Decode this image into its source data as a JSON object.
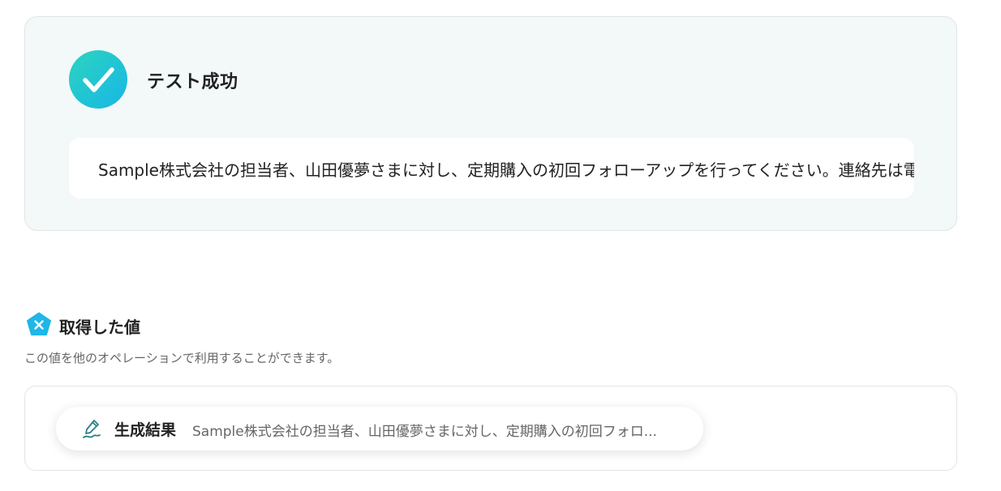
{
  "test_result": {
    "status_title": "テスト成功",
    "output_text": "Sample株式会社の担当者、山田優夢さまに対し、定期購入の初回フォローアップを行ってください。連絡先は電"
  },
  "retrieved_values": {
    "title": "取得した値",
    "description": "この値を他のオペレーションで利用することができます。",
    "items": [
      {
        "label": "生成結果",
        "value": "Sample株式会社の担当者、山田優夢さまに対し、定期購入の初回フォロ..."
      }
    ]
  },
  "colors": {
    "accent_start": "#2dd4bf",
    "accent_end": "#19b6e6",
    "icon_blue": "#1fb6e8",
    "pen_teal": "#2a7f86"
  },
  "icons": {
    "success": "check-circle-icon",
    "values": "variable-pentagon-icon",
    "generated": "pen-icon"
  }
}
